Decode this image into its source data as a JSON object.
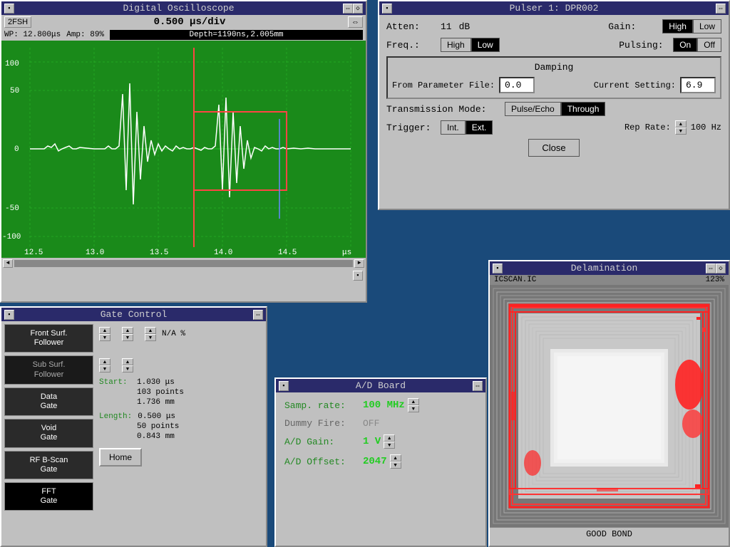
{
  "oscilloscope": {
    "title": "Digital Oscilloscope",
    "rate": "0.500 μs/div",
    "wp_info": "WP: 12.800μs",
    "amp_info": "Amp: 89%",
    "depth_label": "Depth=1190ns,2.005mm",
    "x_axis_unit": "μs",
    "x_labels": [
      "12.5",
      "13.0",
      "13.5",
      "14.0",
      "14.5"
    ],
    "y_labels": [
      "100",
      "50",
      "0",
      "-50",
      "-100"
    ],
    "fssh_label": "2FSH"
  },
  "pulser": {
    "title": "Pulser 1: DPR002",
    "atten_label": "Atten:",
    "atten_value": "11",
    "atten_unit": "dB",
    "gain_label": "Gain:",
    "gain_high": "High",
    "gain_low": "Low",
    "gain_active": "high",
    "freq_label": "Freq.:",
    "freq_high": "High",
    "freq_low": "Low",
    "freq_active": "low",
    "pulsing_label": "Pulsing:",
    "pulsing_on": "On",
    "pulsing_off": "Off",
    "pulsing_active": "on",
    "damping_title": "Damping",
    "from_param_label": "From Parameter File:",
    "from_param_value": "0.0",
    "current_setting_label": "Current Setting:",
    "current_setting_value": "6.9",
    "trans_mode_label": "Transmission Mode:",
    "pulse_echo": "Pulse/Echo",
    "through": "Through",
    "trans_active": "through",
    "trigger_label": "Trigger:",
    "trig_int": "Int.",
    "trig_ext": "Ext.",
    "trig_active": "ext",
    "rep_rate_label": "Rep Rate:",
    "rep_rate_value": "100 Hz",
    "close_label": "Close"
  },
  "gate_control": {
    "title": "Gate Control",
    "buttons": [
      {
        "label": "Front Surf.\nFollower",
        "lines": [
          "Front Surf.",
          "Follower"
        ]
      },
      {
        "label": "Sub Surf.\nFollower",
        "lines": [
          "Sub Surf.",
          "Follower"
        ]
      },
      {
        "label": "Data\nGate",
        "lines": [
          "Data",
          "Gate"
        ]
      },
      {
        "label": "Void\nGate",
        "lines": [
          "Void",
          "Gate"
        ]
      },
      {
        "label": "RF B-Scan\nGate",
        "lines": [
          "RF B-Scan",
          "Gate"
        ]
      },
      {
        "label": "FFT\nGate",
        "lines": [
          "FFT",
          "Gate"
        ]
      }
    ],
    "na_label": "N/A %",
    "start_label": "Start:",
    "start_value": "1.030 μs",
    "start_points": "103 points",
    "start_mm": "1.736 mm",
    "length_label": "Length:",
    "length_value": "0.500 μs",
    "length_points": "50 points",
    "length_mm": "0.843 mm",
    "home_label": "Home"
  },
  "ad_board": {
    "title": "A/D Board",
    "samp_rate_label": "Samp. rate:",
    "samp_rate_value": "100 MHz",
    "dummy_fire_label": "Dummy Fire:",
    "dummy_fire_value": "OFF",
    "gain_label": "A/D Gain:",
    "gain_value": "1 V",
    "offset_label": "A/D Offset:",
    "offset_value": "2047"
  },
  "delamination": {
    "title": "Delamination",
    "subtitle": "ICSCAN.IC",
    "scan_num": "123%",
    "status": "GOOD BOND"
  }
}
